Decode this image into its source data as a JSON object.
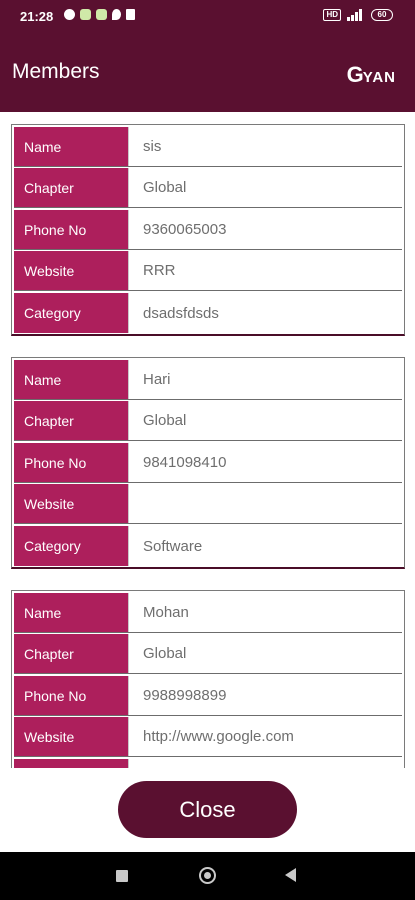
{
  "status_bar": {
    "time": "21:28",
    "right_badge": "HD",
    "battery": "60",
    "icons_left": [
      "chat-icon",
      "app-icon",
      "app-icon",
      "location-icon",
      "trash-icon"
    ]
  },
  "app_bar": {
    "title": "Members",
    "brand_g": "G",
    "brand_rest": "YAN"
  },
  "labels": {
    "name": "Name",
    "chapter": "Chapter",
    "phone": "Phone No",
    "website": "Website",
    "category": "Category"
  },
  "members": [
    {
      "name": "sis",
      "chapter": "Global",
      "phone": "9360065003",
      "website": "RRR",
      "category": "dsadsfdsds"
    },
    {
      "name": "Hari",
      "chapter": "Global",
      "phone": "9841098410",
      "website": "",
      "category": "Software"
    },
    {
      "name": "Mohan",
      "chapter": "Global",
      "phone": "9988998899",
      "website": "http://www.google.com",
      "category": ""
    }
  ],
  "close_button": {
    "label": "Close"
  },
  "colors": {
    "primary_dark": "#5a1030",
    "label_bg": "#ad1f5c",
    "value_text": "#6e6e6e"
  }
}
